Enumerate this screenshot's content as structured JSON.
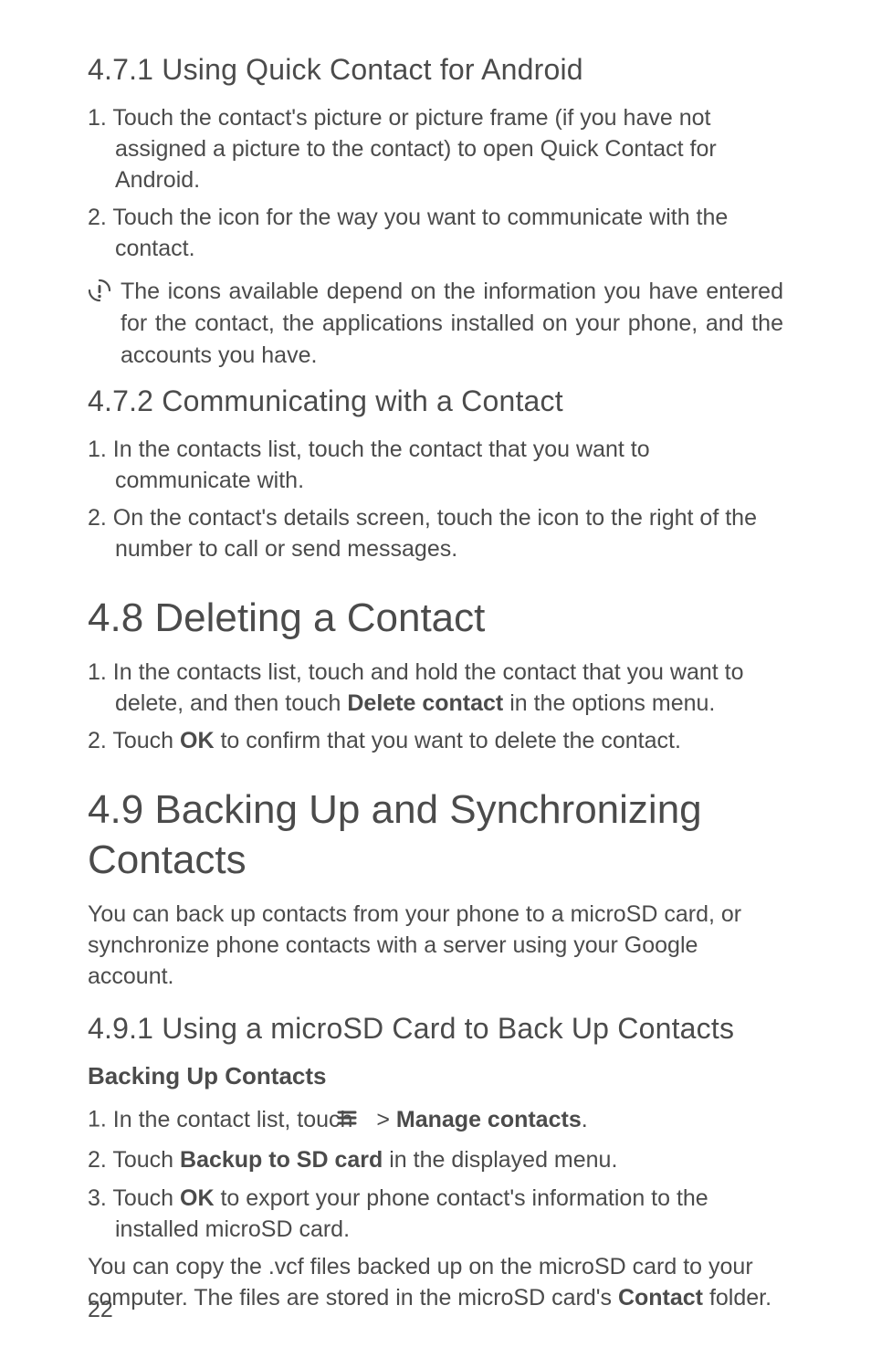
{
  "page_number": "22",
  "sec_4_7_1": {
    "heading": "4.7.1  Using Quick Contact for Android",
    "item1_num": "1. ",
    "item1": "Touch the contact's picture or picture frame (if you have not assigned a picture to the contact) to open Quick Contact for Android.",
    "item2_num": "2. ",
    "item2": "Touch the icon for the way you want to communicate with the contact.",
    "note": "The icons available depend on the information you have entered for the contact, the applications installed on your phone, and the accounts you have."
  },
  "sec_4_7_2": {
    "heading": "4.7.2  Communicating with a Contact",
    "item1_num": "1. ",
    "item1": "In the contacts list, touch the contact that you want to communicate with.",
    "item2_num": "2. ",
    "item2": "On the contact's details screen, touch the icon to the right of the number to call or send messages."
  },
  "sec_4_8": {
    "heading": "4.8  Deleting a Contact",
    "item1_num": "1. ",
    "item1_pre": "In the contacts list, touch and hold the contact that you want to delete, and then touch ",
    "item1_bold": "Delete contact",
    "item1_post": " in the options menu.",
    "item2_num": "2. ",
    "item2_pre": "Touch ",
    "item2_bold": "OK",
    "item2_post": " to confirm that you want to delete the contact."
  },
  "sec_4_9": {
    "heading": "4.9  Backing Up and Synchronizing Contacts",
    "intro": "You can back up contacts from your phone to a microSD card, or synchronize phone contacts with a server using your Google account."
  },
  "sec_4_9_1": {
    "heading": "4.9.1  Using a microSD Card to Back Up Contacts",
    "subheading": "Backing Up Contacts",
    "item1_num": "1. ",
    "item1_pre": "In the contact list, touch ",
    "item1_sep": "  > ",
    "item1_bold": "Manage contacts",
    "item1_post": ".",
    "item2_num": "2. ",
    "item2_pre": "Touch ",
    "item2_bold": "Backup to SD card",
    "item2_post": " in the displayed menu.",
    "item3_num": "3. ",
    "item3_pre": "Touch ",
    "item3_bold": "OK",
    "item3_post": " to export your phone contact's information to the installed microSD card.",
    "footer_pre": "You can copy the .vcf files backed up on the microSD card to your computer. The files are stored in the microSD card's ",
    "footer_bold": "Contact",
    "footer_post": " folder."
  }
}
